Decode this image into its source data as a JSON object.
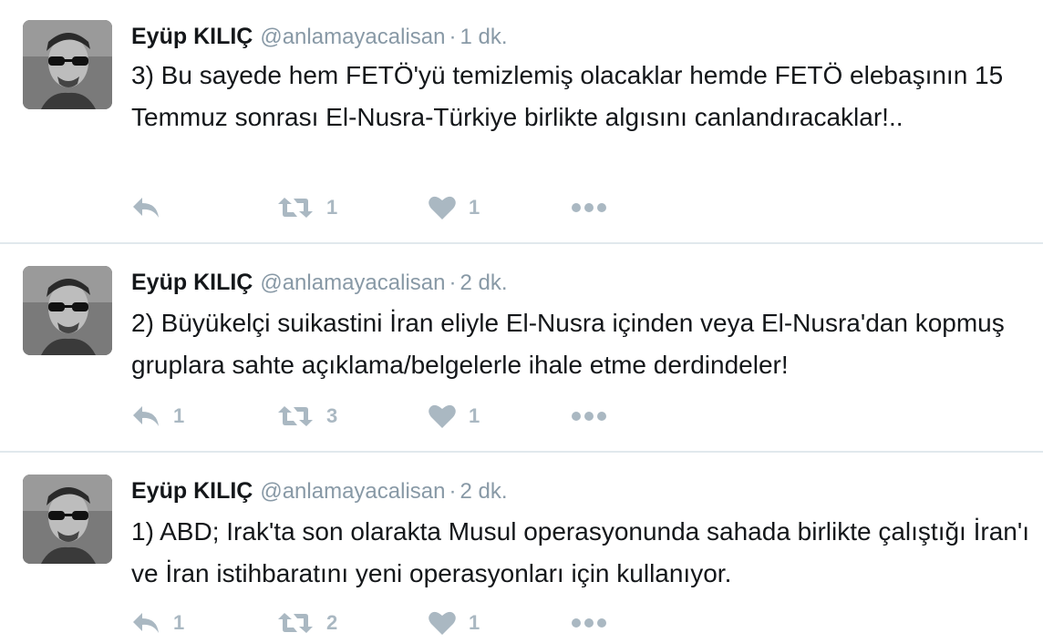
{
  "colors": {
    "text": "#14171a",
    "meta": "#8899a6",
    "icon": "#aab8c2",
    "divider": "#e1e8ed"
  },
  "tweets": [
    {
      "name": "Eyüp KILIÇ",
      "handle": "@anlamayacalisan",
      "separator": "·",
      "time": "1 dk.",
      "text": "3) Bu sayede hem FETÖ'yü temizlemiş olacaklar hemde FETÖ elebaşının 15 Temmuz sonrası El-Nusra-Türkiye birlikte algısını canlandıracaklar!..",
      "replies": "",
      "retweets": "1",
      "likes": "1"
    },
    {
      "name": "Eyüp KILIÇ",
      "handle": "@anlamayacalisan",
      "separator": "·",
      "time": "2 dk.",
      "text": "2) Büyükelçi suikastini İran eliyle El-Nusra içinden veya El-Nusra'dan kopmuş gruplara sahte açıklama/belgelerle ihale etme derdindeler!",
      "replies": "1",
      "retweets": "3",
      "likes": "1"
    },
    {
      "name": "Eyüp KILIÇ",
      "handle": "@anlamayacalisan",
      "separator": "·",
      "time": "2 dk.",
      "text": "1) ABD; Irak'ta son olarakta Musul operasyonunda sahada birlikte çalıştığı İran'ı ve İran istihbaratını yeni operasyonları için kullanıyor.",
      "replies": "1",
      "retweets": "2",
      "likes": "1"
    }
  ]
}
